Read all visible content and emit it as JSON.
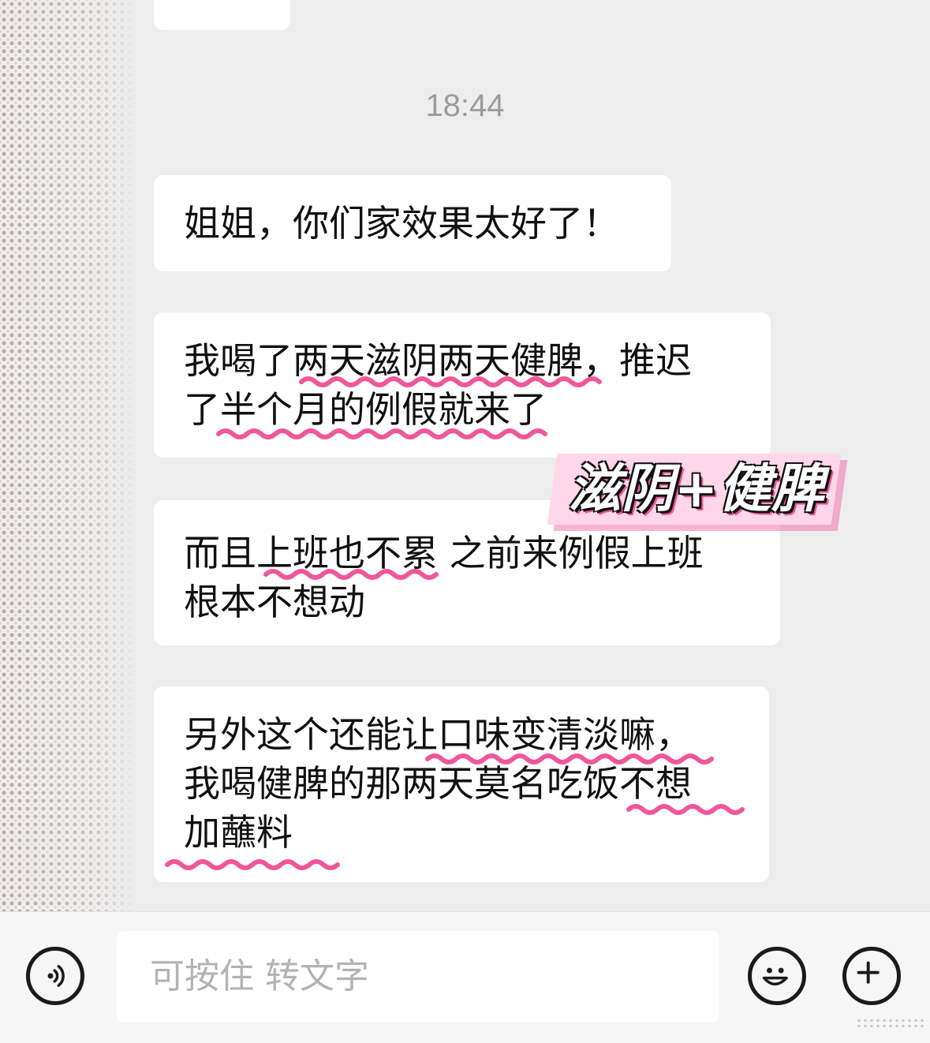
{
  "chat": {
    "time": "18:44",
    "messages": [
      {
        "lines": [
          "姐姐，你们家效果太好了！"
        ]
      },
      {
        "lines": [
          "我喝了两天滋阴两天健脾，推迟",
          "了半个月的例假就来了"
        ]
      },
      {
        "lines": [
          "而且上班也不累 之前来例假上班",
          "根本不想动"
        ]
      },
      {
        "lines": [
          "另外这个还能让口味变清淡嘛，",
          "我喝健脾的那两天莫名吃饭不想",
          "加蘸料"
        ]
      }
    ]
  },
  "sticker": {
    "text": "滋阴+健脾"
  },
  "input_bar": {
    "placeholder": "可按住 转文字",
    "icons": {
      "voice": "voice-icon",
      "emoji": "emoji-icon",
      "more": "plus-icon"
    }
  },
  "colors": {
    "background": "#ededed",
    "bubble": "#ffffff",
    "text": "#111111",
    "timestamp": "#9b9b9b",
    "highlight": "#f0569a",
    "sticker_bg": "#ffd7e8"
  }
}
